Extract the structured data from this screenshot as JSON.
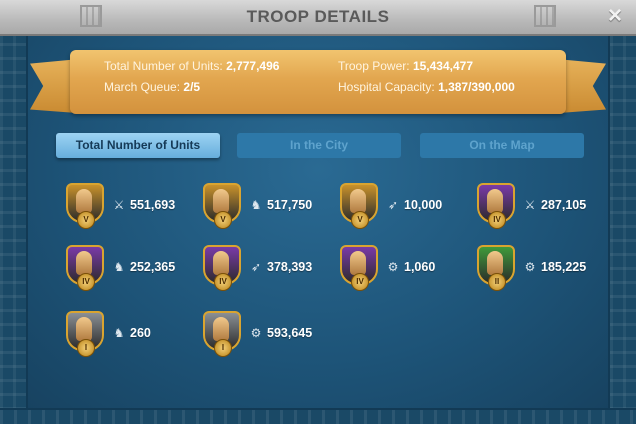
{
  "window": {
    "title": "TROOP DETAILS",
    "close_icon": "×"
  },
  "summary": {
    "total_units_label": "Total Number of Units:",
    "total_units_value": "2,777,496",
    "troop_power_label": "Troop Power:",
    "troop_power_value": "15,434,477",
    "march_queue_label": "March Queue:",
    "march_queue_value": "2/5",
    "hospital_label": "Hospital Capacity:",
    "hospital_value": "1,387/390,000"
  },
  "tabs": [
    {
      "label": "Total Number of Units",
      "active": true
    },
    {
      "label": "In the City",
      "active": false
    },
    {
      "label": "On the Map",
      "active": false
    }
  ],
  "units": [
    {
      "tier": "V",
      "type_icon": "infantry-icon",
      "glyph": "⚔",
      "count": "551,693",
      "frame": "gold"
    },
    {
      "tier": "V",
      "type_icon": "cavalry-icon",
      "glyph": "♞",
      "count": "517,750",
      "frame": "gold"
    },
    {
      "tier": "V",
      "type_icon": "archer-icon",
      "glyph": "➶",
      "count": "10,000",
      "frame": "gold"
    },
    {
      "tier": "IV",
      "type_icon": "infantry-icon",
      "glyph": "⚔",
      "count": "287,105",
      "frame": "purple"
    },
    {
      "tier": "IV",
      "type_icon": "cavalry-icon",
      "glyph": "♞",
      "count": "252,365",
      "frame": "purple"
    },
    {
      "tier": "IV",
      "type_icon": "archer-icon",
      "glyph": "➶",
      "count": "378,393",
      "frame": "purple"
    },
    {
      "tier": "IV",
      "type_icon": "siege-icon",
      "glyph": "⚙",
      "count": "1,060",
      "frame": "purple"
    },
    {
      "tier": "II",
      "type_icon": "siege-icon",
      "glyph": "⚙",
      "count": "185,225",
      "frame": "green"
    },
    {
      "tier": "I",
      "type_icon": "cavalry-icon",
      "glyph": "♞",
      "count": "260",
      "frame": "gray"
    },
    {
      "tier": "I",
      "type_icon": "siege-icon",
      "glyph": "⚙",
      "count": "593,645",
      "frame": "gray"
    }
  ],
  "colors": {
    "gold": "#c8912b",
    "purple": "#7a3aa8",
    "green": "#3f9a3a",
    "gray": "#8a8f94",
    "accent": "#66aedc"
  }
}
